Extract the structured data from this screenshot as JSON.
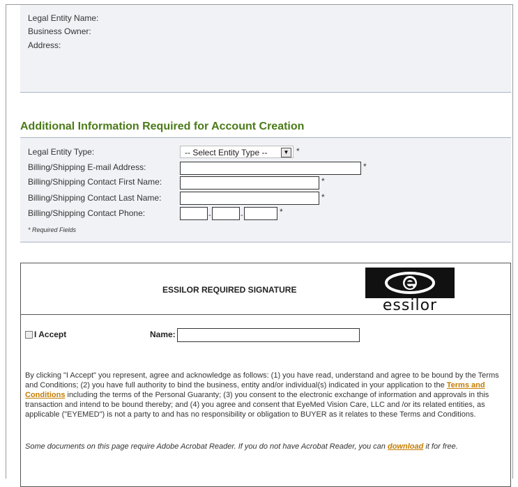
{
  "entity_info": {
    "legal_entity_name_label": "Legal Entity Name:",
    "business_owner_label": "Business Owner:",
    "address_label": "Address:"
  },
  "additional_info": {
    "title": "Additional Information Required for Account Creation",
    "legal_entity_type_label": "Legal Entity Type:",
    "legal_entity_type_selected": "-- Select Entity Type --",
    "email_label": "Billing/Shipping E-mail Address:",
    "email_value": "",
    "first_name_label": "Billing/Shipping Contact First Name:",
    "first_name_value": "",
    "last_name_label": "Billing/Shipping Contact Last Name:",
    "last_name_value": "",
    "phone_label": "Billing/Shipping Contact Phone:",
    "phone_area": "",
    "phone_prefix": "",
    "phone_line": "",
    "required_marker": "*",
    "phone_separator": "-",
    "required_note": "* Required Fields"
  },
  "signature": {
    "title": "ESSILOR REQUIRED SIGNATURE",
    "logo_text": "essilor",
    "accept_label": "I Accept",
    "accept_checked": false,
    "name_label": "Name:",
    "name_value": "",
    "terms_before": "By clicking \"I Accept\" you represent, agree and acknowledge as follows: (1) you have read, understand and agree to be bound by the Terms and Conditions; (2) you have full authority to bind the business, entity and/or individual(s) indicated in your application to the ",
    "terms_link": "Terms and Conditions",
    "terms_after": " including the terms of the Personal Guaranty; (3) you consent to the electronic exchange of information and approvals in this transaction and intend to be bound thereby; and (4) you agree and consent that EyeMed Vision Care, LLC and /or its related entities, as applicable (\"EYEMED\") is not a party to and has no responsibility or obligation to BUYER as it relates to these Terms and Conditions.",
    "acrobat_before": "Some documents on this page require Adobe Acrobat Reader. If you do not have Acrobat Reader, you can ",
    "acrobat_link": "download",
    "acrobat_after": " it for free."
  },
  "colors": {
    "section_title": "#4b7a18",
    "panel_bg": "#f1f2f6",
    "link": "#c47c00"
  }
}
